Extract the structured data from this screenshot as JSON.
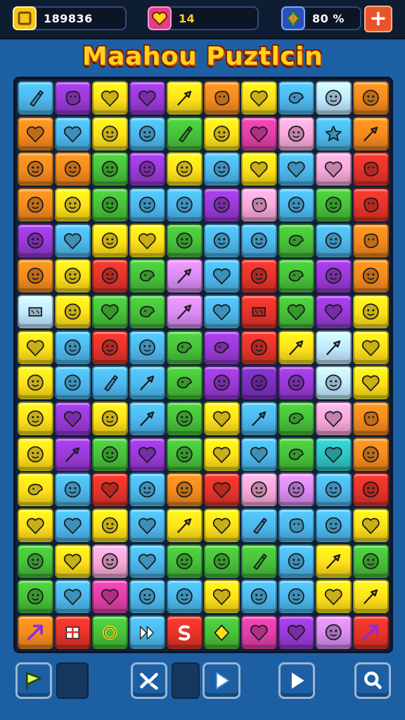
{
  "hud": {
    "coins": {
      "value": "189836",
      "icon": "coin-icon",
      "color": "#f5c518"
    },
    "lives": {
      "value": "14",
      "icon": "heart-icon",
      "color": "#e23e8e"
    },
    "gems": {
      "value": "80 %",
      "icon": "gem-icon",
      "color": "#2a4fb8"
    },
    "plus_label": "+"
  },
  "title": "Maahou Puztlcin",
  "palette": {
    "B": "#4db8ee",
    "P": "#9a3ad8",
    "Y": "#ffe01a",
    "O": "#f58a1e",
    "R": "#e5342a",
    "G": "#47c13a",
    "K": "#f7a8d8",
    "L": "#bfe8ff",
    "V": "#d98cf2",
    "C": "#2fc4c4",
    "M": "#e03fa8",
    "N": "#7b2fbf"
  },
  "board": {
    "columns": 10,
    "rows": [
      {
        "tiles": [
          [
            "B",
            "bottle"
          ],
          [
            "P",
            "blob"
          ],
          [
            "Y",
            "heart"
          ],
          [
            "P",
            "heart"
          ],
          [
            "Y",
            "tool"
          ],
          [
            "O",
            "blob"
          ],
          [
            "Y",
            "heart"
          ],
          [
            "B",
            "bird"
          ],
          [
            "L",
            "face"
          ],
          [
            "O",
            "face"
          ]
        ]
      },
      {
        "tiles": [
          [
            "O",
            "heart"
          ],
          [
            "B",
            "heart"
          ],
          [
            "Y",
            "face"
          ],
          [
            "B",
            "face"
          ],
          [
            "G",
            "bottle"
          ],
          [
            "Y",
            "face"
          ],
          [
            "M",
            "heart"
          ],
          [
            "K",
            "face"
          ],
          [
            "B",
            "star"
          ],
          [
            "O",
            "tool"
          ]
        ]
      },
      {
        "tiles": [
          [
            "O",
            "face"
          ],
          [
            "O",
            "face"
          ],
          [
            "G",
            "face"
          ],
          [
            "P",
            "face"
          ],
          [
            "Y",
            "face"
          ],
          [
            "B",
            "face"
          ],
          [
            "Y",
            "heart"
          ],
          [
            "B",
            "heart"
          ],
          [
            "K",
            "heart"
          ],
          [
            "R",
            "blob"
          ]
        ]
      },
      {
        "tiles": [
          [
            "O",
            "face"
          ],
          [
            "Y",
            "face"
          ],
          [
            "G",
            "face"
          ],
          [
            "B",
            "face"
          ],
          [
            "B",
            "face"
          ],
          [
            "P",
            "face"
          ],
          [
            "K",
            "blob"
          ],
          [
            "B",
            "face"
          ],
          [
            "G",
            "face"
          ],
          [
            "R",
            "blob"
          ]
        ]
      },
      {
        "tiles": [
          [
            "P",
            "face"
          ],
          [
            "B",
            "heart"
          ],
          [
            "Y",
            "face"
          ],
          [
            "Y",
            "heart"
          ],
          [
            "G",
            "face"
          ],
          [
            "B",
            "face"
          ],
          [
            "B",
            "face"
          ],
          [
            "G",
            "bird"
          ],
          [
            "B",
            "face"
          ],
          [
            "O",
            "blob"
          ]
        ]
      },
      {
        "tiles": [
          [
            "O",
            "face"
          ],
          [
            "Y",
            "face"
          ],
          [
            "R",
            "face"
          ],
          [
            "G",
            "bird"
          ],
          [
            "V",
            "tool"
          ],
          [
            "B",
            "heart"
          ],
          [
            "R",
            "face"
          ],
          [
            "G",
            "bird"
          ],
          [
            "P",
            "face"
          ],
          [
            "O",
            "face"
          ]
        ]
      },
      {
        "tiles": [
          [
            "L",
            "flag"
          ],
          [
            "Y",
            "face"
          ],
          [
            "G",
            "heart"
          ],
          [
            "G",
            "bird"
          ],
          [
            "V",
            "tool"
          ],
          [
            "B",
            "heart"
          ],
          [
            "R",
            "flag"
          ],
          [
            "G",
            "heart"
          ],
          [
            "P",
            "heart"
          ],
          [
            "Y",
            "face"
          ]
        ]
      },
      {
        "tiles": [
          [
            "Y",
            "heart"
          ],
          [
            "B",
            "face"
          ],
          [
            "R",
            "face"
          ],
          [
            "B",
            "face"
          ],
          [
            "G",
            "bird"
          ],
          [
            "P",
            "bird"
          ],
          [
            "R",
            "face"
          ],
          [
            "Y",
            "tool"
          ],
          [
            "L",
            "tool"
          ],
          [
            "Y",
            "heart"
          ]
        ]
      },
      {
        "tiles": [
          [
            "Y",
            "face"
          ],
          [
            "B",
            "face"
          ],
          [
            "B",
            "bottle"
          ],
          [
            "B",
            "tool"
          ],
          [
            "G",
            "bird"
          ],
          [
            "P",
            "face"
          ],
          [
            "N",
            "face"
          ],
          [
            "P",
            "face"
          ],
          [
            "L",
            "face"
          ],
          [
            "Y",
            "heart"
          ]
        ]
      },
      {
        "tiles": [
          [
            "Y",
            "face"
          ],
          [
            "P",
            "heart"
          ],
          [
            "Y",
            "face"
          ],
          [
            "B",
            "tool"
          ],
          [
            "G",
            "face"
          ],
          [
            "Y",
            "heart"
          ],
          [
            "B",
            "tool"
          ],
          [
            "G",
            "bird"
          ],
          [
            "K",
            "heart"
          ],
          [
            "O",
            "blob"
          ]
        ]
      },
      {
        "tiles": [
          [
            "Y",
            "face"
          ],
          [
            "P",
            "tool"
          ],
          [
            "G",
            "face"
          ],
          [
            "P",
            "heart"
          ],
          [
            "G",
            "face"
          ],
          [
            "Y",
            "heart"
          ],
          [
            "B",
            "heart"
          ],
          [
            "G",
            "bird"
          ],
          [
            "C",
            "heart"
          ],
          [
            "O",
            "face"
          ]
        ]
      },
      {
        "tiles": [
          [
            "Y",
            "bird"
          ],
          [
            "B",
            "face"
          ],
          [
            "R",
            "heart"
          ],
          [
            "B",
            "face"
          ],
          [
            "O",
            "face"
          ],
          [
            "R",
            "heart"
          ],
          [
            "K",
            "face"
          ],
          [
            "V",
            "face"
          ],
          [
            "B",
            "face"
          ],
          [
            "R",
            "face"
          ]
        ]
      },
      {
        "tiles": [
          [
            "Y",
            "heart"
          ],
          [
            "B",
            "heart"
          ],
          [
            "Y",
            "face"
          ],
          [
            "B",
            "heart"
          ],
          [
            "Y",
            "tool"
          ],
          [
            "Y",
            "heart"
          ],
          [
            "B",
            "bottle"
          ],
          [
            "B",
            "blob"
          ],
          [
            "B",
            "face"
          ],
          [
            "Y",
            "heart"
          ]
        ]
      },
      {
        "tiles": [
          [
            "G",
            "face"
          ],
          [
            "Y",
            "heart"
          ],
          [
            "K",
            "face"
          ],
          [
            "B",
            "heart"
          ],
          [
            "G",
            "face"
          ],
          [
            "G",
            "face"
          ],
          [
            "G",
            "bottle"
          ],
          [
            "B",
            "face"
          ],
          [
            "Y",
            "tool"
          ],
          [
            "G",
            "face"
          ]
        ]
      },
      {
        "tiles": [
          [
            "G",
            "face"
          ],
          [
            "B",
            "heart"
          ],
          [
            "M",
            "heart"
          ],
          [
            "B",
            "face"
          ],
          [
            "B",
            "face"
          ],
          [
            "Y",
            "heart"
          ],
          [
            "B",
            "face"
          ],
          [
            "B",
            "face"
          ],
          [
            "Y",
            "heart"
          ],
          [
            "Y",
            "tool"
          ]
        ]
      },
      {
        "tiles": [
          [
            "O",
            "arrow"
          ],
          [
            "R",
            "gift"
          ],
          [
            "G",
            "ring"
          ],
          [
            "B",
            "play"
          ],
          [
            "R",
            "swirl"
          ],
          [
            "G",
            "diamond"
          ],
          [
            "M",
            "heart"
          ],
          [
            "P",
            "heart"
          ],
          [
            "V",
            "face"
          ],
          [
            "R",
            "arrow"
          ]
        ]
      }
    ]
  },
  "bottom": {
    "buttons": [
      {
        "name": "flag-button",
        "icon": "flag-icon",
        "color": "#59c02e"
      },
      {
        "name": "shuffle-button",
        "icon": "shuffle-icon",
        "color": "#3a9fe8"
      },
      {
        "name": "play-button",
        "icon": "play-icon",
        "color": "#a9dcff"
      },
      {
        "name": "next-button",
        "icon": "next-icon",
        "color": "#2c8fe0"
      },
      {
        "name": "search-button",
        "icon": "search-icon",
        "color": "#f2762a"
      }
    ]
  }
}
